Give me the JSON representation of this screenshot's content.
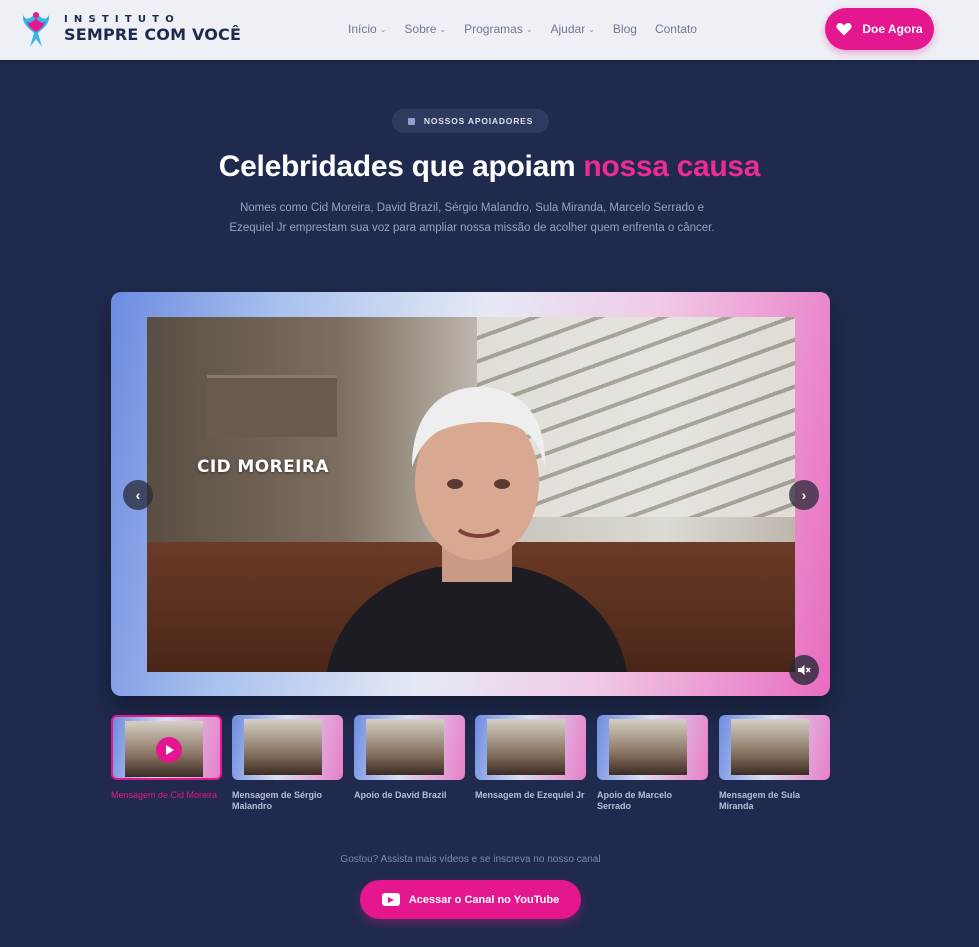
{
  "header": {
    "logo_top": "INSTITUTO",
    "logo_bottom": "SEMPRE COM VOCÊ",
    "nav": [
      {
        "label": "Início",
        "has_dropdown": true
      },
      {
        "label": "Sobre",
        "has_dropdown": true
      },
      {
        "label": "Programas",
        "has_dropdown": true
      },
      {
        "label": "Ajudar",
        "has_dropdown": true
      },
      {
        "label": "Blog",
        "has_dropdown": false
      },
      {
        "label": "Contato",
        "has_dropdown": false
      }
    ],
    "donate_label": "Doe Agora"
  },
  "section": {
    "badge": "NOSSOS APOIADORES",
    "title_main": "Celebridades que apoiam",
    "title_highlight": "nossa causa",
    "subtitle": "Nomes como Cid Moreira, David Brazil, Sérgio Malandro, Sula Miranda, Marcelo Serrado e Ezequiel Jr emprestam sua voz para ampliar nossa missão de acolher quem enfrenta o câncer."
  },
  "player": {
    "overlay_name": "CID MOREIRA",
    "muted": true
  },
  "thumbnails": [
    {
      "label": "Mensagem de Cid Moreira",
      "active": true
    },
    {
      "label": "Mensagem de Sérgio Malandro",
      "active": false
    },
    {
      "label": "Apoio de David Brazil",
      "active": false
    },
    {
      "label": "Mensagem de Ezequiel Jr",
      "active": false
    },
    {
      "label": "Apoio de Marcelo Serrado",
      "active": false
    },
    {
      "label": "Mensagem de Sula Miranda",
      "active": false
    }
  ],
  "cta": {
    "text": "Gostou? Assista mais vídeos e se inscreva no nosso canal",
    "button_label": "Acessar o Canal no YouTube"
  },
  "colors": {
    "brand_pink": "#e5178f",
    "background": "#1f2a4e",
    "header_bg": "#eef0f6"
  }
}
